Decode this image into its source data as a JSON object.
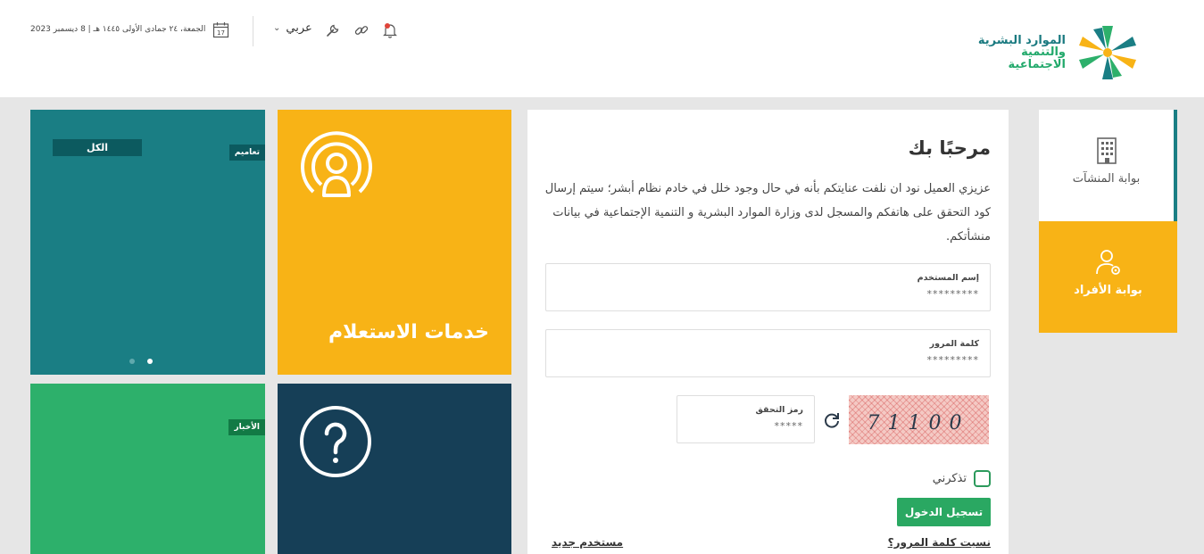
{
  "header": {
    "date_text": "الجمعة، ٢٤ جمادى الأولى ١٤٤٥ هـ | 8 ديسمبر 2023",
    "calendar_day": "17",
    "language_label": "عربي",
    "logo_line1": "الموارد البشرية",
    "logo_line2": "والتنمية الاجتماعية",
    "icons": [
      "calendar-icon",
      "chevron-down-icon",
      "wrench-icon",
      "link-icon",
      "bell-icon"
    ]
  },
  "tiles": {
    "news": {
      "tab_label": "الكل",
      "badge_label": "تعاميم",
      "slide_count": 2,
      "active_slide": 2
    },
    "inquiry": {
      "title": "خدمات الاستعلام",
      "icon": "inquiry-person-icon"
    },
    "news2": {
      "badge_label": "الأخبار"
    },
    "help": {
      "icon": "question-icon"
    }
  },
  "login": {
    "title": "مرحبًا بك",
    "intro": "عزيزي العميل نود ان نلفت عنايتكم بأنه في حال وجود خلل في خادم نظام أبشر؛ سيتم إرسال كود التحقق على هاتفكم والمسجل لدى وزارة الموارد البشرية و التنمية الإجتماعية في بيانات منشأتكم.",
    "username_label": "إسم المستخدم",
    "username_value": "*********",
    "password_label": "كلمة المرور",
    "password_value": "*********",
    "captcha_label": "رمز التحقق",
    "captcha_value": "*****",
    "captcha_text": "71100",
    "remember_label": "تذكرني",
    "login_button": "تسجيل الدخول",
    "forgot_password": "نسيت كلمة المرور؟",
    "new_user": "مستخدم جديد"
  },
  "portals": {
    "establishments": "بوابة المنشآت",
    "individuals": "بوابة الأفراد"
  },
  "colors": {
    "teal": "#1a7e84",
    "yellow": "#f8b316",
    "green": "#2db06b",
    "navy": "#163f57",
    "button_green": "#2aa862"
  }
}
